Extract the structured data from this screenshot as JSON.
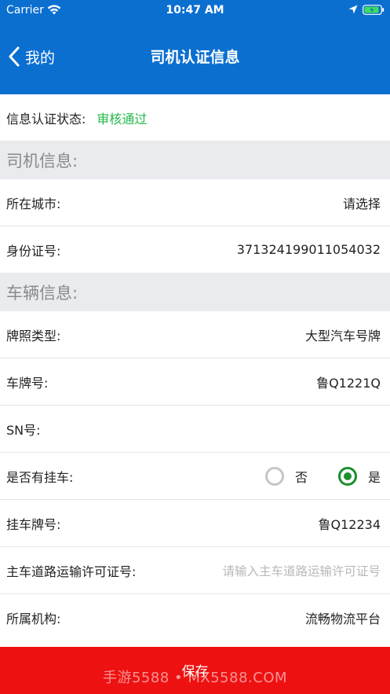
{
  "status_bar": {
    "carrier": "Carrier",
    "time": "10:47 AM"
  },
  "nav": {
    "back_label": "我的",
    "title": "司机认证信息"
  },
  "auth_status": {
    "label": "信息认证状态:",
    "value": "审核通过",
    "value_color": "#22b84a"
  },
  "driver_section": {
    "title": "司机信息:"
  },
  "city": {
    "label": "所在城市:",
    "value": "请选择"
  },
  "id_card": {
    "label": "身份证号:",
    "value": "371324199011054032"
  },
  "vehicle_section": {
    "title": "车辆信息:"
  },
  "plate_type": {
    "label": "牌照类型:",
    "value": "大型汽车号牌"
  },
  "plate_number": {
    "label": "车牌号:",
    "value": "鲁Q1221Q"
  },
  "sn": {
    "label": "SN号:",
    "value": ""
  },
  "trailer": {
    "label": "是否有挂车:",
    "option_no": "否",
    "option_yes": "是",
    "selected": "是"
  },
  "trailer_plate": {
    "label": "挂车牌号:",
    "value": "鲁Q12234"
  },
  "permit": {
    "label": "主车道路运输许可证号:",
    "placeholder": "请输入主车道路运输许可证号"
  },
  "organization": {
    "label": "所属机构:",
    "value": "流畅物流平台"
  },
  "save": {
    "label": "保存"
  },
  "watermark": {
    "text": "手游5588 • MX5588.COM"
  },
  "colors": {
    "nav": "#0b6fd0",
    "save": "#ee1111",
    "radio_on": "#1a8f2c"
  }
}
